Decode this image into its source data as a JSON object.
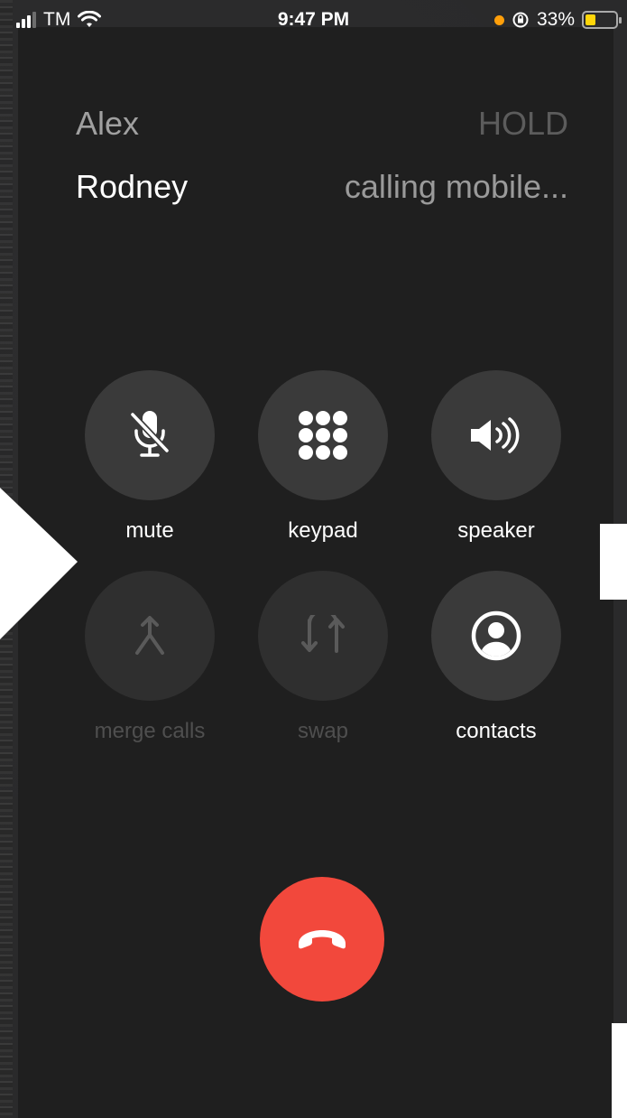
{
  "status_bar": {
    "carrier": "TM",
    "time": "9:47 PM",
    "battery_percent": "33%",
    "battery_level": 0.33,
    "orange_indicator": "#ff9f0a"
  },
  "calls": [
    {
      "name": "Alex",
      "state": "HOLD"
    },
    {
      "name": "Rodney",
      "state": "calling mobile..."
    }
  ],
  "controls": {
    "mute": {
      "label": "mute",
      "icon": "mic-off-icon",
      "enabled": true
    },
    "keypad": {
      "label": "keypad",
      "icon": "keypad-icon",
      "enabled": true
    },
    "speaker": {
      "label": "speaker",
      "icon": "speaker-icon",
      "enabled": true
    },
    "merge": {
      "label": "merge calls",
      "icon": "merge-icon",
      "enabled": false
    },
    "swap": {
      "label": "swap",
      "icon": "swap-icon",
      "enabled": false
    },
    "contacts": {
      "label": "contacts",
      "icon": "contact-icon",
      "enabled": true
    }
  },
  "end_call": {
    "icon": "phone-hangup-icon",
    "color": "#f2483c"
  }
}
